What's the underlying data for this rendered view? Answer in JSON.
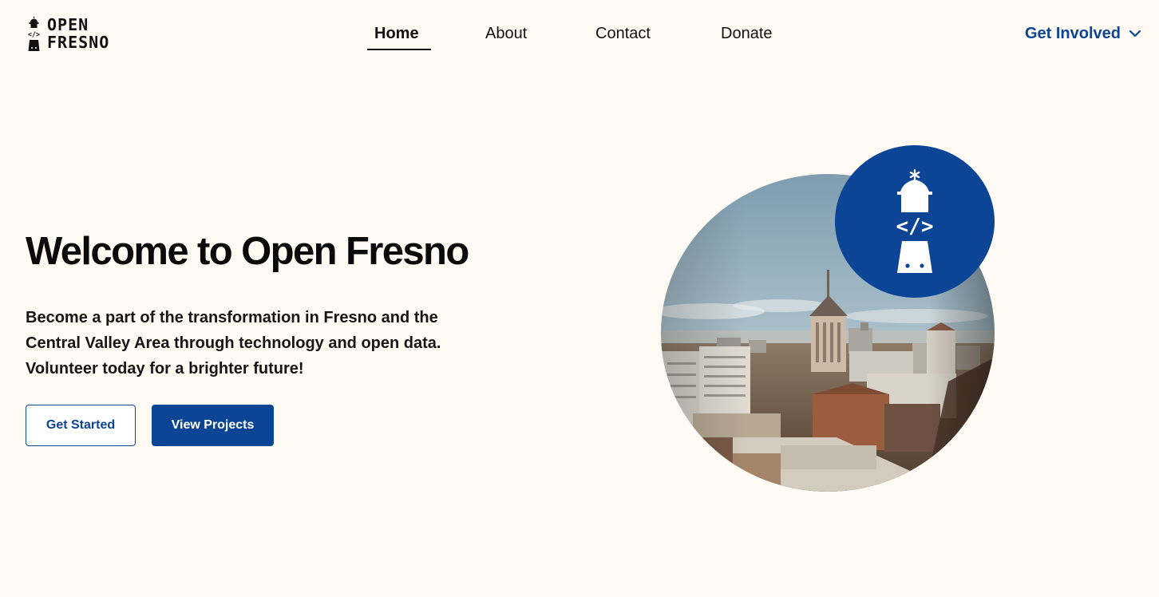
{
  "brand": {
    "line1": "OPEN",
    "line2": "FRESNO",
    "icon": "lighthouse-code-icon"
  },
  "nav": {
    "items": [
      {
        "label": "Home",
        "active": true
      },
      {
        "label": "About",
        "active": false
      },
      {
        "label": "Contact",
        "active": false
      },
      {
        "label": "Donate",
        "active": false
      }
    ],
    "get_involved": {
      "label": "Get Involved",
      "icon": "chevron-down-icon"
    }
  },
  "hero": {
    "title": "Welcome to Open Fresno",
    "description": "Become a part of the transformation in Fresno and the Central Valley Area through technology and open data. Volunteer today for a brighter future!",
    "buttons": {
      "get_started": "Get Started",
      "view_projects": "View Projects"
    },
    "image": {
      "subject": "fresno-downtown-aerial-photo",
      "badge_icon": "lighthouse-code-icon"
    }
  },
  "colors": {
    "background": "#fffbf4",
    "accent": "#0c4595",
    "text": "#111111"
  }
}
